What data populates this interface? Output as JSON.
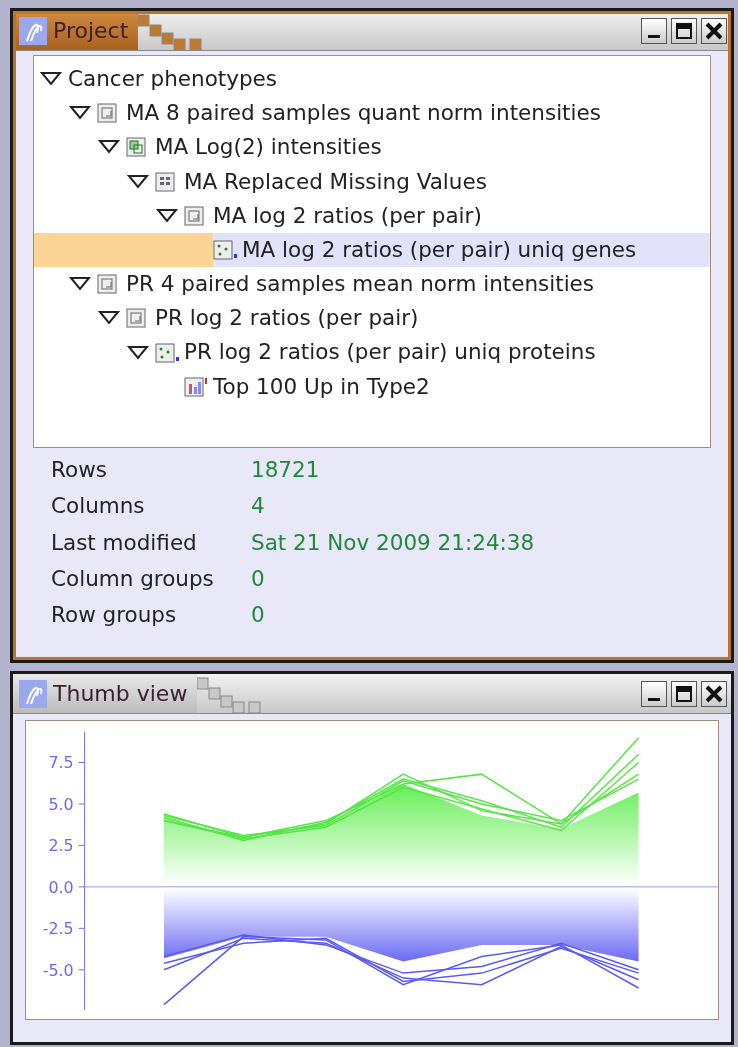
{
  "project_window": {
    "title": "Project",
    "active": true,
    "tree": [
      {
        "label": "Cancer phenotypes",
        "expanded": true,
        "selected": false,
        "children": [
          {
            "label": "MA 8 paired samples quant norm intensities",
            "kind": "dataset",
            "expanded": true,
            "selected": false,
            "children": [
              {
                "label": "MA Log(2) intensities",
                "kind": "transform",
                "expanded": true,
                "selected": false,
                "children": [
                  {
                    "label": "MA Replaced Missing Values",
                    "kind": "grid",
                    "expanded": true,
                    "selected": false,
                    "children": [
                      {
                        "label": "MA log 2 ratios (per pair)",
                        "kind": "dataset",
                        "expanded": true,
                        "selected": false,
                        "children": [
                          {
                            "label": "MA log 2 ratios (per pair) uniq genes",
                            "kind": "scatter",
                            "selected": true
                          }
                        ]
                      }
                    ]
                  }
                ]
              }
            ]
          },
          {
            "label": "PR 4 paired samples mean norm intensities",
            "kind": "dataset",
            "expanded": true,
            "selected": false,
            "children": [
              {
                "label": "PR log 2 ratios (per pair)",
                "kind": "dataset",
                "expanded": true,
                "selected": false,
                "children": [
                  {
                    "label": "PR log 2 ratios (per pair) uniq proteins",
                    "kind": "scatter",
                    "expanded": true,
                    "selected": false,
                    "children": [
                      {
                        "label": "Top 100 Up in Type2",
                        "kind": "chart",
                        "selected": false
                      }
                    ]
                  }
                ]
              }
            ]
          }
        ]
      }
    ],
    "properties": [
      {
        "label": "Rows",
        "value": "18721"
      },
      {
        "label": "Columns",
        "value": "4"
      },
      {
        "label": "Last modified",
        "value": "Sat 21 Nov 2009 21:24:38"
      },
      {
        "label": "Column groups",
        "value": "0"
      },
      {
        "label": "Row groups",
        "value": "0"
      }
    ]
  },
  "thumb_window": {
    "title": "Thumb view",
    "active": false,
    "plot": {
      "y_axis_labels": [
        "7.5",
        "5.0",
        "2.5",
        "0.0",
        "-2.5",
        "-5.0"
      ]
    }
  }
}
